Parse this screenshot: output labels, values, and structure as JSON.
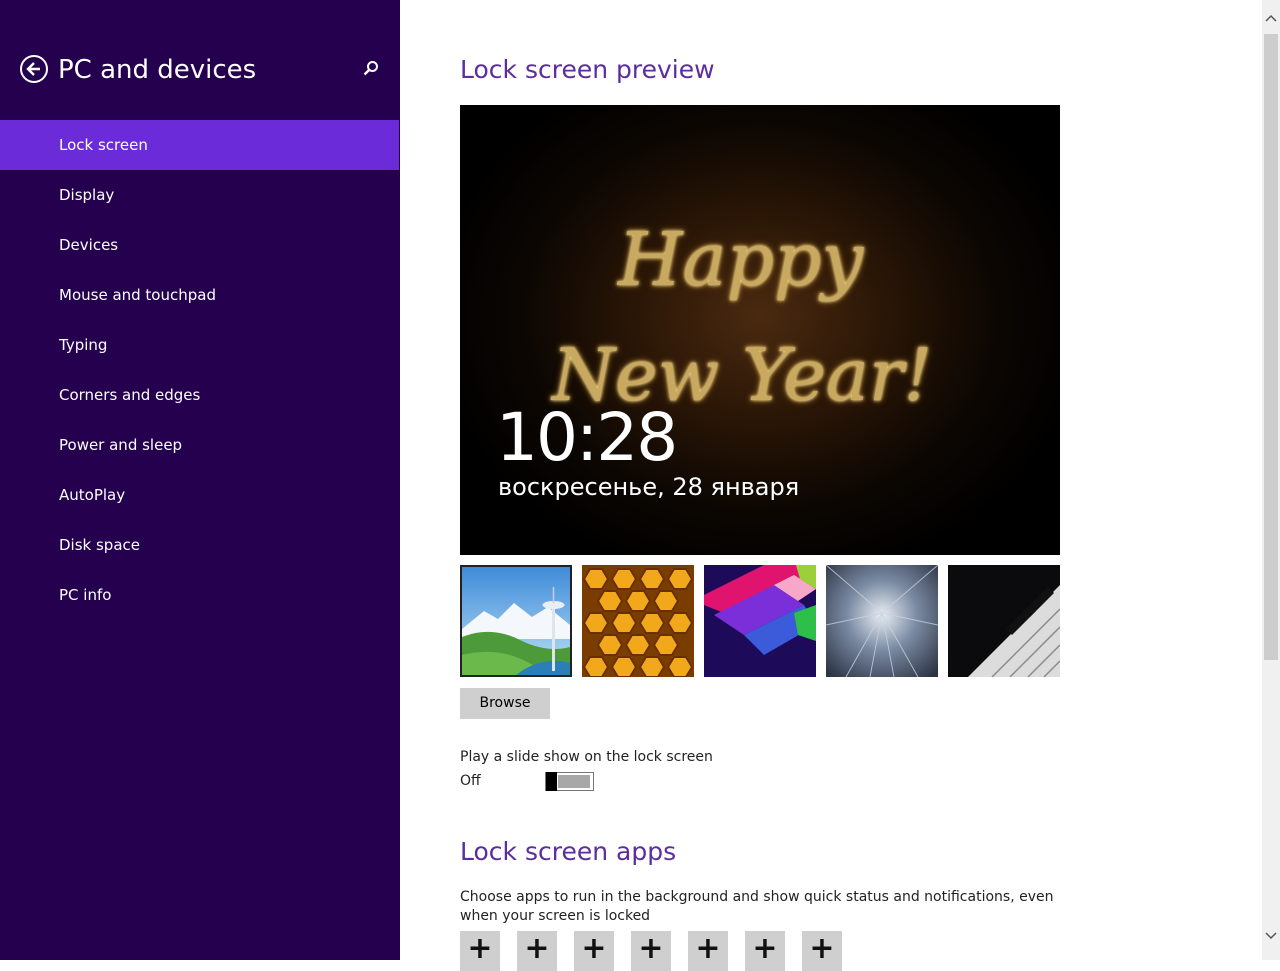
{
  "sidebar": {
    "title": "PC and devices",
    "items": [
      {
        "label": "Lock screen",
        "active": true
      },
      {
        "label": "Display"
      },
      {
        "label": "Devices"
      },
      {
        "label": "Mouse and touchpad"
      },
      {
        "label": "Typing"
      },
      {
        "label": "Corners and edges"
      },
      {
        "label": "Power and sleep"
      },
      {
        "label": "AutoPlay"
      },
      {
        "label": "Disk space"
      },
      {
        "label": "PC info"
      }
    ]
  },
  "main": {
    "preview_heading": "Lock screen preview",
    "preview": {
      "image_text_line1": "Happy",
      "image_text_line2": "New Year!",
      "time": "10:28",
      "date": "воскресенье, 28 января"
    },
    "browse_label": "Browse",
    "slideshow": {
      "label": "Play a slide show on the lock screen",
      "state": "Off"
    },
    "apps_heading": "Lock screen apps",
    "apps_description": "Choose apps to run in the background and show quick status and notifications, even when your screen is locked",
    "app_slot_symbol": "+"
  },
  "colors": {
    "sidebar_bg": "#24004f",
    "active_item": "#6c2bd9",
    "heading": "#5b2d9e"
  }
}
